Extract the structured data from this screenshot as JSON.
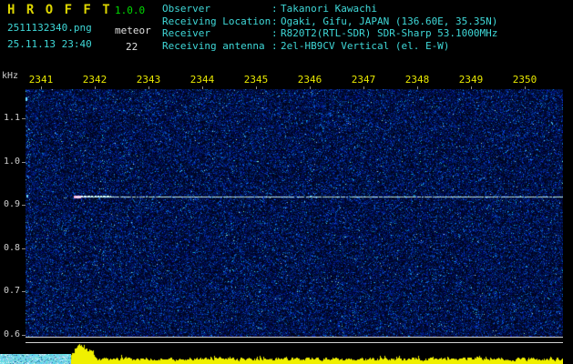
{
  "header": {
    "app_title": "H R O F F T",
    "version": "1.0.0",
    "filename": "2511132340.png",
    "mode_label": "meteor",
    "datetime": "25.11.13 23:40",
    "meteor_count": "22",
    "colon": ":",
    "info": [
      {
        "label": "Observer",
        "value": "Takanori Kawachi"
      },
      {
        "label": "Receiving Location",
        "value": "Ogaki, Gifu, JAPAN (136.60E, 35.35N)"
      },
      {
        "label": "Receiver",
        "value": "R820T2(RTL-SDR) SDR-Sharp 53.1000MHz"
      },
      {
        "label": "Receiving antenna",
        "value": "2el-HB9CV Vertical (el. E-W)"
      }
    ]
  },
  "chart_data": {
    "type": "heatmap",
    "title": "",
    "xlabel": "",
    "ylabel": "kHz",
    "x_ticks": [
      "2341",
      "2342",
      "2343",
      "2344",
      "2345",
      "2346",
      "2347",
      "2348",
      "2349",
      "2350"
    ],
    "y_ticks": [
      "1.1",
      "1.0",
      "0.9",
      "0.8",
      "0.7",
      "0.6"
    ],
    "x_range_hhmm": [
      "2340",
      "2350"
    ],
    "ylim_khz": [
      0.6,
      1.17
    ],
    "grid": false,
    "legend": false,
    "series": [
      {
        "name": "meteor-echo-trace",
        "type": "line",
        "freq_khz": 0.92,
        "start_minute": 2340.9,
        "end_minute": 2350,
        "note": "bright continuous horizontal echo line at ~0.92 kHz, brightest (white/pink head) just before 23:41, extending to right edge"
      },
      {
        "name": "signal-strength-strip",
        "type": "area",
        "burst_minute": 2340.9,
        "note": "yellow relative signal level strip along the bottom with a strong burst spike coincident with the echo start"
      }
    ]
  },
  "colors": {
    "background": "#000000",
    "title_yellow": "#ddd600",
    "version_green": "#00dc00",
    "cyan_text": "#3fd8d8",
    "white_text": "#e0e0e0",
    "axis_label": "#cfcfcf",
    "time_label_yellow": "#e8e800",
    "noise_deep_blue": "#000a28",
    "echo_white": "#f0ffff",
    "echo_head_pink": "#ffb0e0",
    "power_yellow": "#f0f000",
    "separator_white": "#d0d0d0",
    "corner_cyan": "#7fd8ee"
  }
}
